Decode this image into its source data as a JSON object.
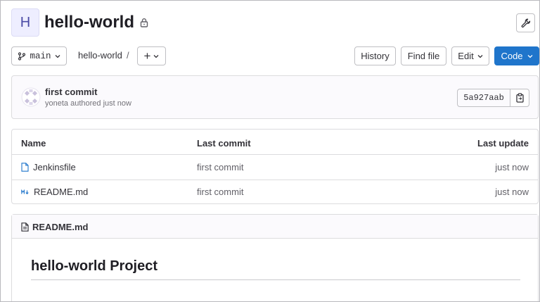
{
  "project": {
    "avatar_letter": "H",
    "name": "hello-world",
    "visibility_icon": "lock-icon",
    "settings_icon": "wrench-icon"
  },
  "toolbar": {
    "branch": "main",
    "breadcrumb": "hello-world",
    "breadcrumb_separator": "/",
    "add_label": "+",
    "history_label": "History",
    "find_file_label": "Find file",
    "edit_label": "Edit",
    "code_label": "Code"
  },
  "last_commit": {
    "title": "first commit",
    "meta": "yoneta authored just now",
    "sha": "5a927aab",
    "copy_icon": "copy-icon"
  },
  "file_table": {
    "headers": {
      "name": "Name",
      "last_commit": "Last commit",
      "last_update": "Last update"
    },
    "rows": [
      {
        "name": "Jenkinsfile",
        "icon": "file-icon",
        "last_commit": "first commit",
        "last_update": "just now"
      },
      {
        "name": "README.md",
        "icon": "markdown-icon",
        "last_commit": "first commit",
        "last_update": "just now"
      }
    ]
  },
  "readme": {
    "file_name": "README.md",
    "heading": "hello-world Project"
  },
  "colors": {
    "primary": "#1f75cb",
    "avatar_bg": "#eeeeff",
    "file_icon": "#1f75cb"
  }
}
